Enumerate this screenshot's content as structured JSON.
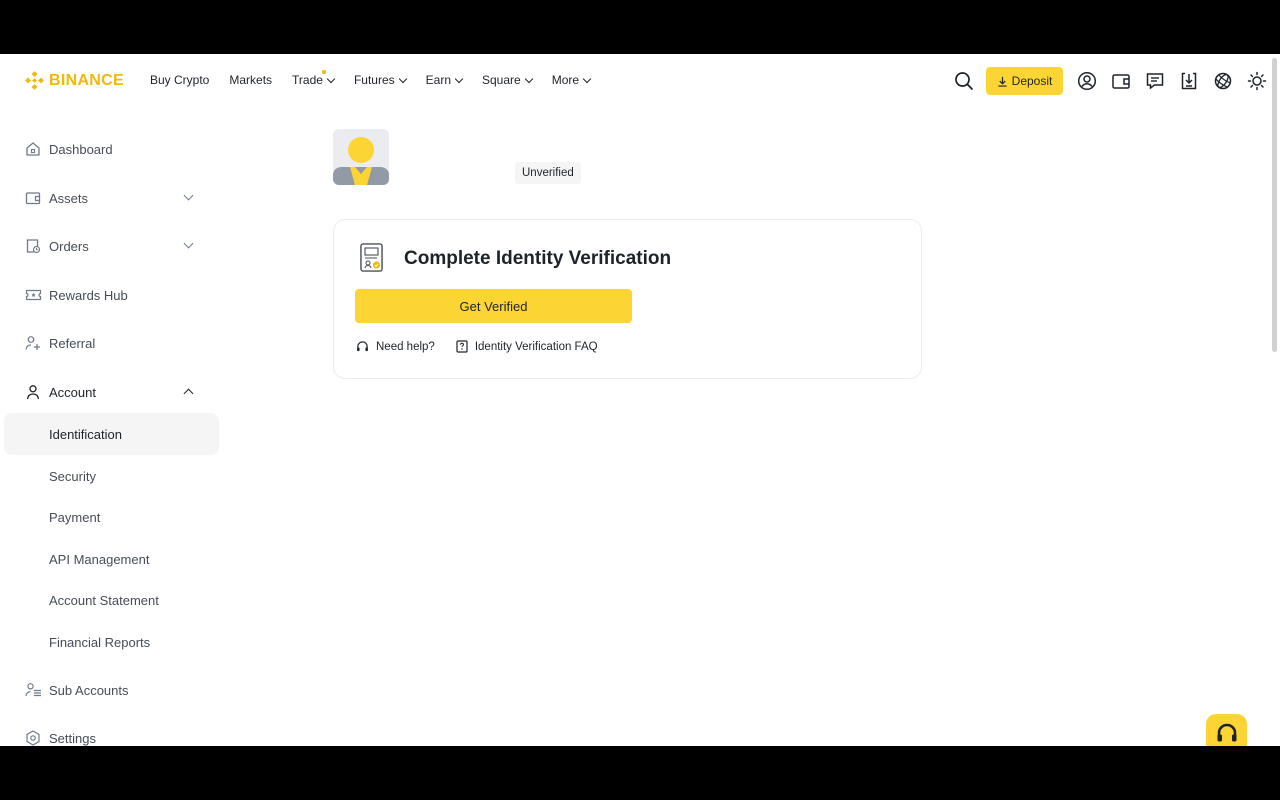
{
  "brand": {
    "name": "BINANCE",
    "accent_color": "#f0b90b",
    "button_color": "#fcd535"
  },
  "nav": {
    "items": [
      {
        "label": "Buy Crypto",
        "dropdown": false
      },
      {
        "label": "Markets",
        "dropdown": false
      },
      {
        "label": "Trade",
        "dropdown": true
      },
      {
        "label": "Futures",
        "dropdown": true
      },
      {
        "label": "Earn",
        "dropdown": true
      },
      {
        "label": "Square",
        "dropdown": true
      },
      {
        "label": "More",
        "dropdown": true
      }
    ],
    "deposit_label": "Deposit",
    "icons": [
      "search-icon",
      "download-arrow-icon",
      "user-circle-icon",
      "wallet-icon",
      "message-icon",
      "app-download-icon",
      "globe-icon",
      "sun-icon"
    ]
  },
  "sidebar": {
    "items": [
      {
        "label": "Dashboard",
        "icon": "home-icon"
      },
      {
        "label": "Assets",
        "icon": "wallet-icon"
      },
      {
        "label": "Orders",
        "icon": "orders-icon"
      },
      {
        "label": "Rewards Hub",
        "icon": "ticket-icon"
      },
      {
        "label": "Referral",
        "icon": "add-user-icon"
      },
      {
        "label": "Account",
        "icon": "user-icon"
      }
    ],
    "account_sub": [
      {
        "label": "Identification"
      },
      {
        "label": "Security"
      },
      {
        "label": "Payment"
      },
      {
        "label": "API Management"
      },
      {
        "label": "Account Statement"
      },
      {
        "label": "Financial Reports"
      }
    ],
    "bottom_items": [
      {
        "label": "Sub Accounts",
        "icon": "sub-accounts-icon"
      },
      {
        "label": "Settings",
        "icon": "settings-icon"
      }
    ]
  },
  "profile": {
    "status": "Unverified"
  },
  "verification_card": {
    "title": "Complete Identity Verification",
    "button_label": "Get Verified",
    "help_label": "Need help?",
    "faq_label": "Identity Verification FAQ"
  }
}
